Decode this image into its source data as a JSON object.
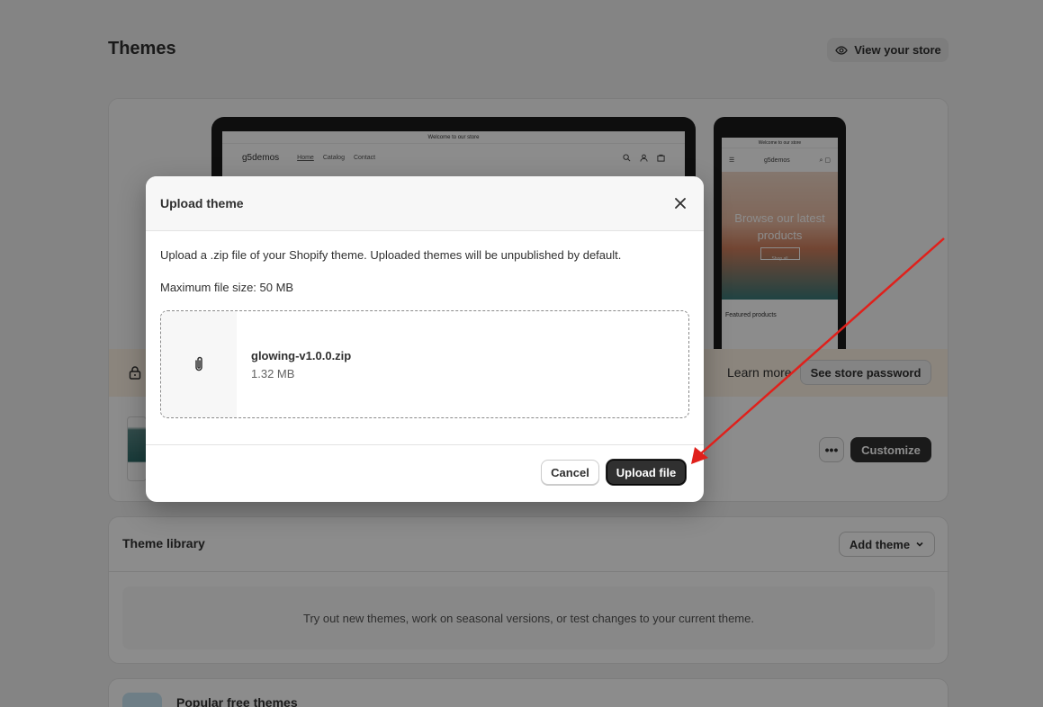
{
  "page": {
    "title": "Themes",
    "view_store_label": "View your store"
  },
  "current_theme": {
    "laptop_preview": {
      "announcement": "Welcome to our store",
      "logo": "g5demos",
      "nav": [
        "Home",
        "Catalog",
        "Contact"
      ]
    },
    "phone_preview": {
      "announcement": "Welcome to our store",
      "logo": "g5demos",
      "hero_text": "Browse our latest products",
      "hero_button": "Shop all",
      "featured_label": "Featured products"
    },
    "password_bar": {
      "learn_more": "Learn more",
      "see_password_label": "See store password"
    },
    "actions": {
      "more_label": "•••",
      "customize_label": "Customize"
    }
  },
  "theme_library": {
    "title": "Theme library",
    "add_theme_label": "Add theme",
    "empty_text": "Try out new themes, work on seasonal versions, or test changes to your current theme."
  },
  "popular": {
    "title": "Popular free themes"
  },
  "modal": {
    "title": "Upload theme",
    "description": "Upload a .zip file of your Shopify theme. Uploaded themes will be unpublished by default.",
    "max_size": "Maximum file size: 50 MB",
    "file": {
      "name": "glowing-v1.0.0.zip",
      "size": "1.32 MB"
    },
    "cancel_label": "Cancel",
    "upload_label": "Upload file"
  },
  "annotation": {
    "arrow_color": "#e0201b"
  }
}
